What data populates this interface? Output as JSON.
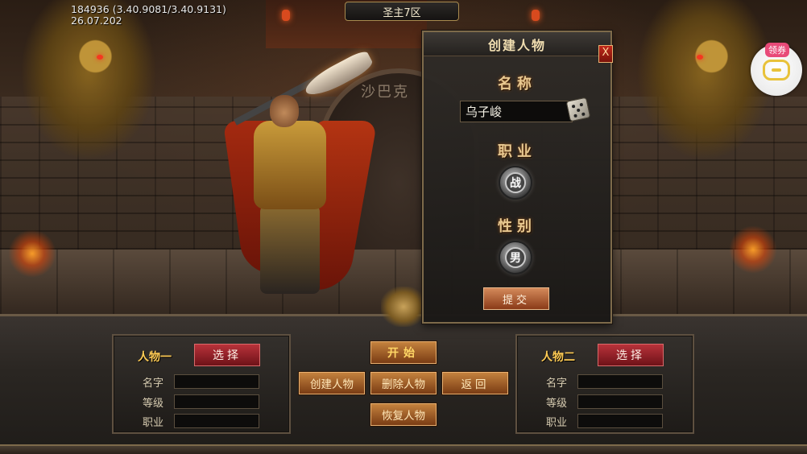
{
  "debug": {
    "line1": "184936 (3.40.9081/3.40.9131)",
    "line2": "26.07.202"
  },
  "server": {
    "name": "圣主7区"
  },
  "scene": {
    "engraving": "沙巴克"
  },
  "coupon": {
    "label": "领券",
    "icon": "gamepad-icon"
  },
  "dialog": {
    "title": "创建人物",
    "close_label": "X",
    "name_label": "名称",
    "name_value": "乌子峻",
    "job_label": "职业",
    "job_value": "战",
    "gender_label": "性别",
    "gender_value": "男",
    "submit_label": "提交"
  },
  "slots": [
    {
      "title": "人物一",
      "select_label": "选择",
      "fields": [
        "名字",
        "等级",
        "职业"
      ]
    },
    {
      "title": "人物二",
      "select_label": "选择",
      "fields": [
        "名字",
        "等级",
        "职业"
      ]
    }
  ],
  "actions": {
    "start": "开始",
    "create": "创建人物",
    "delete": "删除人物",
    "back": "返回",
    "restore": "恢复人物"
  },
  "colors": {
    "accent_gold": "#ffcc55",
    "select_red": "#b8323a",
    "button_bronze": "#c4823e"
  }
}
